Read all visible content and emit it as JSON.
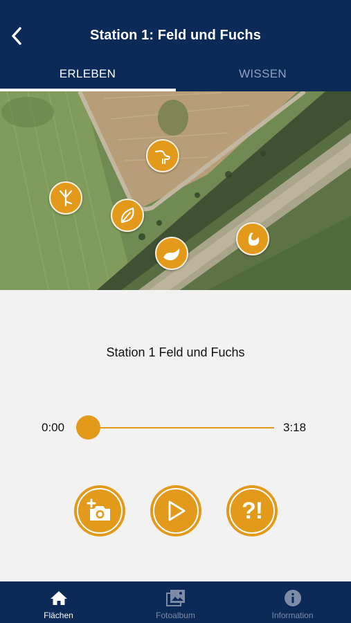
{
  "header": {
    "title": "Station 1: Feld und Fuchs",
    "back_icon": "chevron-left-icon"
  },
  "tabs": [
    {
      "label": "ERLEBEN",
      "active": true
    },
    {
      "label": "WISSEN",
      "active": false
    }
  ],
  "map": {
    "markers": [
      {
        "icon": "heron-icon"
      },
      {
        "icon": "bird-track-icon"
      },
      {
        "icon": "leaf-icon"
      },
      {
        "icon": "swan-icon"
      },
      {
        "icon": "wave-icon"
      }
    ]
  },
  "player": {
    "title": "Station 1 Feld und Fuchs",
    "time_start": "0:00",
    "time_end": "3:18",
    "progress": 0
  },
  "actions": {
    "camera_icon": "add-photo-icon",
    "play_icon": "play-icon",
    "quiz_label": "?!"
  },
  "tabbar": [
    {
      "label": "Flächen",
      "icon": "home-icon",
      "active": true
    },
    {
      "label": "Fotoalbum",
      "icon": "photo-album-icon",
      "active": false
    },
    {
      "label": "Information",
      "icon": "info-icon",
      "active": false
    }
  ],
  "colors": {
    "primary": "#0b2a57",
    "accent": "#e39a1b",
    "background": "#f2f2f2",
    "inactive": "#7c8ca6"
  }
}
